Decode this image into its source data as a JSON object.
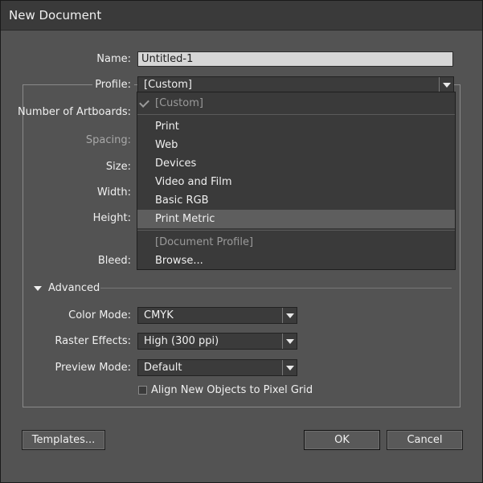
{
  "window": {
    "title": "New Document"
  },
  "form": {
    "name_label": "Name:",
    "name_value": "Untitled-1",
    "profile_label": "Profile:",
    "profile_value": "[Custom]",
    "artboards_label": "Number of Artboards:",
    "spacing_label": "Spacing:",
    "size_label": "Size:",
    "width_label": "Width:",
    "height_label": "Height:",
    "bleed_label": "Bleed:"
  },
  "profile_menu": {
    "items": [
      {
        "label": "[Custom]",
        "checked": true,
        "disabled": true
      },
      {
        "label": "Print"
      },
      {
        "label": "Web"
      },
      {
        "label": "Devices"
      },
      {
        "label": "Video and Film"
      },
      {
        "label": "Basic RGB"
      },
      {
        "label": "Print Metric",
        "highlighted": true
      },
      {
        "label": "[Document Profile]",
        "disabled": true
      },
      {
        "label": "Browse..."
      }
    ]
  },
  "advanced": {
    "toggle_label": "Advanced",
    "color_mode_label": "Color Mode:",
    "color_mode_value": "CMYK",
    "raster_label": "Raster Effects:",
    "raster_value": "High (300 ppi)",
    "preview_label": "Preview Mode:",
    "preview_value": "Default",
    "align_label": "Align New Objects to Pixel Grid",
    "align_checked": false
  },
  "buttons": {
    "templates": "Templates...",
    "ok": "OK",
    "cancel": "Cancel"
  }
}
